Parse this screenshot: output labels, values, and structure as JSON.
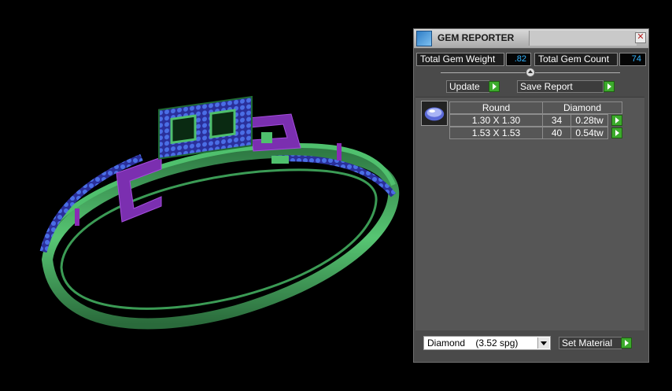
{
  "panel": {
    "title": "GEM REPORTER",
    "total_gem_weight_label": "Total Gem Weight",
    "total_gem_weight_value": ".82",
    "total_gem_count_label": "Total Gem Count",
    "total_gem_count_value": "74"
  },
  "toolbar": {
    "update_label": "Update",
    "save_report_label": "Save Report"
  },
  "gem_table": {
    "headers": {
      "shape": "Round",
      "material": "Diamond"
    },
    "rows": [
      {
        "size": "1.30 X 1.30",
        "count": "34",
        "weight": "0.28tw"
      },
      {
        "size": "1.53 X 1.53",
        "count": "40",
        "weight": "0.54tw"
      }
    ]
  },
  "material": {
    "selected": "Diamond    (3.52 spg)",
    "set_material_label": "Set Material"
  },
  "icons": [
    "gem-reporter-app-icon",
    "close-icon",
    "divider-toggle-icon",
    "play-arrow-icon",
    "gem-thumbnail-icon",
    "dropdown-arrow-icon"
  ],
  "colors": {
    "ring_body": "#4fc06d",
    "ring_frame": "#8a2ab5",
    "gems": "#3c5adc",
    "value_text": "#33b5ff",
    "arrow_button": "#3cab2c"
  }
}
